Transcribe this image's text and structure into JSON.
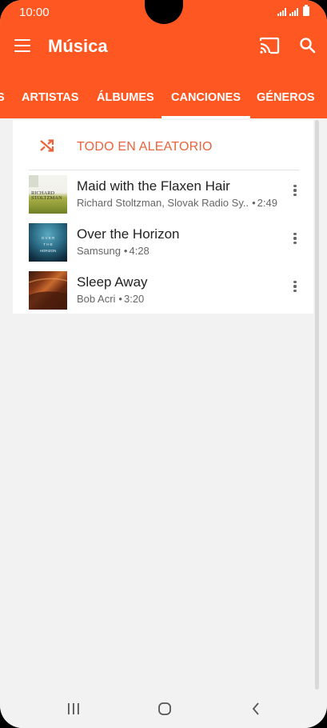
{
  "status_bar": {
    "time": "10:00"
  },
  "app_bar": {
    "title": "Música",
    "icons": [
      "menu-icon",
      "cast-icon",
      "search-icon"
    ]
  },
  "tabs": [
    {
      "label": "S",
      "active": false
    },
    {
      "label": "ARTISTAS",
      "active": false
    },
    {
      "label": "ÁLBUMES",
      "active": false
    },
    {
      "label": "CANCIONES",
      "active": true
    },
    {
      "label": "GÉNEROS",
      "active": false
    }
  ],
  "shuffle": {
    "label": "TODO EN ALEATORIO",
    "icon": "shuffle-icon"
  },
  "songs": [
    {
      "title": "Maid with the Flaxen Hair",
      "artist": "Richard Stoltzman, Slovak Radio Sy..",
      "duration": "2:49",
      "art_text": [
        "RICHARD",
        "STOLTZMAN"
      ]
    },
    {
      "title": "Over the Horizon",
      "artist": "Samsung",
      "duration": "4:28",
      "art_text": [
        "O V E R",
        "T H E",
        "HORIZON"
      ]
    },
    {
      "title": "Sleep Away",
      "artist": "Bob Acri",
      "duration": "3:20",
      "art_text": []
    }
  ],
  "meta_separator": "•",
  "colors": {
    "accent": "#ff5722",
    "shuffle_text": "#e8643c",
    "background": "#f2f2f2"
  }
}
